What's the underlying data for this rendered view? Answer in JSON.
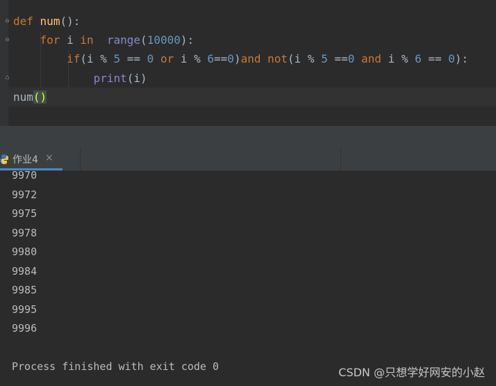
{
  "editor": {
    "lines": [
      {
        "segments": [
          {
            "t": "def",
            "c": "kw"
          },
          {
            "t": " ",
            "c": ""
          },
          {
            "t": "num",
            "c": "fn"
          },
          {
            "t": "():",
            "c": ""
          }
        ]
      },
      {
        "segments": [
          {
            "t": "    ",
            "c": ""
          },
          {
            "t": "for",
            "c": "kw"
          },
          {
            "t": " i ",
            "c": ""
          },
          {
            "t": "in",
            "c": "kw"
          },
          {
            "t": "  ",
            "c": ""
          },
          {
            "t": "range",
            "c": "bi"
          },
          {
            "t": "(",
            "c": ""
          },
          {
            "t": "10000",
            "c": "num"
          },
          {
            "t": "):",
            "c": ""
          }
        ]
      },
      {
        "segments": [
          {
            "t": "        ",
            "c": ""
          },
          {
            "t": "if",
            "c": "kw"
          },
          {
            "t": "(i % ",
            "c": ""
          },
          {
            "t": "5",
            "c": "num"
          },
          {
            "t": " == ",
            "c": ""
          },
          {
            "t": "0",
            "c": "num"
          },
          {
            "t": " ",
            "c": ""
          },
          {
            "t": "or",
            "c": "kw"
          },
          {
            "t": " i % ",
            "c": ""
          },
          {
            "t": "6",
            "c": "num"
          },
          {
            "t": "==",
            "c": ""
          },
          {
            "t": "0",
            "c": "num"
          },
          {
            "t": ")",
            "c": ""
          },
          {
            "t": "and",
            "c": "kw"
          },
          {
            "t": " ",
            "c": ""
          },
          {
            "t": "not",
            "c": "kw"
          },
          {
            "t": "(i % ",
            "c": ""
          },
          {
            "t": "5",
            "c": "num"
          },
          {
            "t": " ==",
            "c": ""
          },
          {
            "t": "0",
            "c": "num"
          },
          {
            "t": " ",
            "c": ""
          },
          {
            "t": "and",
            "c": "kw"
          },
          {
            "t": " i % ",
            "c": ""
          },
          {
            "t": "6",
            "c": "num"
          },
          {
            "t": " == ",
            "c": ""
          },
          {
            "t": "0",
            "c": "num"
          },
          {
            "t": "):",
            "c": ""
          }
        ]
      },
      {
        "segments": [
          {
            "t": "            ",
            "c": ""
          },
          {
            "t": "print",
            "c": "bi"
          },
          {
            "t": "(i)",
            "c": ""
          }
        ]
      },
      {
        "segments": [
          {
            "t": "num",
            "c": ""
          },
          {
            "t": "()",
            "c": "brace-hl"
          }
        ]
      }
    ]
  },
  "run_tab": {
    "label": "作业4",
    "close": "×",
    "icon": "python-icon"
  },
  "console": {
    "output": [
      "9970",
      "9972",
      "9975",
      "9978",
      "9980",
      "9984",
      "9985",
      "9995",
      "9996",
      "",
      "Process finished with exit code 0"
    ]
  },
  "watermark": "CSDN @只想学好网安的小赵",
  "colors": {
    "background": "#2b2b2b",
    "keyword": "#cc7832",
    "function": "#ffc66d",
    "builtin": "#8888c6",
    "number": "#6897bb",
    "text": "#a9b7c6",
    "tab_accent": "#4a88c7"
  }
}
